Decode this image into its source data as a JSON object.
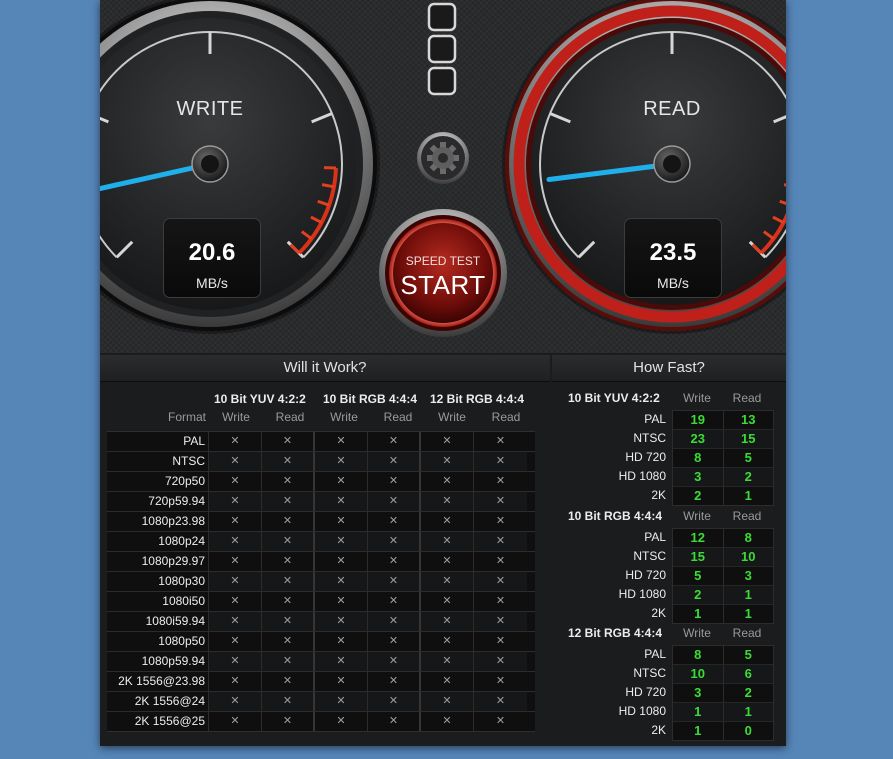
{
  "write_gauge": {
    "label": "WRITE",
    "value": "20.6",
    "unit": "MB/s",
    "needle_fraction": 0.12,
    "needle_color": "#1fb0ec",
    "accent_color": "#d8321b"
  },
  "read_gauge": {
    "label": "READ",
    "value": "23.5",
    "unit": "MB/s",
    "needle_fraction": 0.14,
    "needle_color": "#1fb0ec",
    "ring_color": "#c0201a"
  },
  "start_button": {
    "line1": "SPEED TEST",
    "line2": "START"
  },
  "settings_icon": "gear-icon",
  "view_toggle_icon": "square-icon",
  "will_it_work": {
    "title": "Will it Work?",
    "format_header": "Format",
    "groups": [
      "10 Bit YUV 4:2:2",
      "10 Bit RGB 4:4:4",
      "12 Bit RGB 4:4:4"
    ],
    "sub_headers": [
      "Write",
      "Read"
    ],
    "mark": "✕",
    "formats": [
      "PAL",
      "NTSC",
      "720p50",
      "720p59.94",
      "1080p23.98",
      "1080p24",
      "1080p29.97",
      "1080p30",
      "1080i50",
      "1080i59.94",
      "1080p50",
      "1080p59.94",
      "2K 1556@23.98",
      "2K 1556@24",
      "2K 1556@25"
    ]
  },
  "how_fast": {
    "title": "How Fast?",
    "sections": [
      {
        "title": "10 Bit YUV 4:2:2",
        "write_header": "Write",
        "read_header": "Read",
        "rows": [
          {
            "label": "PAL",
            "write": "19",
            "read": "13"
          },
          {
            "label": "NTSC",
            "write": "23",
            "read": "15"
          },
          {
            "label": "HD 720",
            "write": "8",
            "read": "5"
          },
          {
            "label": "HD 1080",
            "write": "3",
            "read": "2"
          },
          {
            "label": "2K",
            "write": "2",
            "read": "1"
          }
        ]
      },
      {
        "title": "10 Bit RGB 4:4:4",
        "write_header": "Write",
        "read_header": "Read",
        "rows": [
          {
            "label": "PAL",
            "write": "12",
            "read": "8"
          },
          {
            "label": "NTSC",
            "write": "15",
            "read": "10"
          },
          {
            "label": "HD 720",
            "write": "5",
            "read": "3"
          },
          {
            "label": "HD 1080",
            "write": "2",
            "read": "1"
          },
          {
            "label": "2K",
            "write": "1",
            "read": "1"
          }
        ]
      },
      {
        "title": "12 Bit RGB 4:4:4",
        "write_header": "Write",
        "read_header": "Read",
        "rows": [
          {
            "label": "PAL",
            "write": "8",
            "read": "5"
          },
          {
            "label": "NTSC",
            "write": "10",
            "read": "6"
          },
          {
            "label": "HD 720",
            "write": "3",
            "read": "2"
          },
          {
            "label": "HD 1080",
            "write": "1",
            "read": "1"
          },
          {
            "label": "2K",
            "write": "1",
            "read": "0"
          }
        ]
      }
    ]
  }
}
